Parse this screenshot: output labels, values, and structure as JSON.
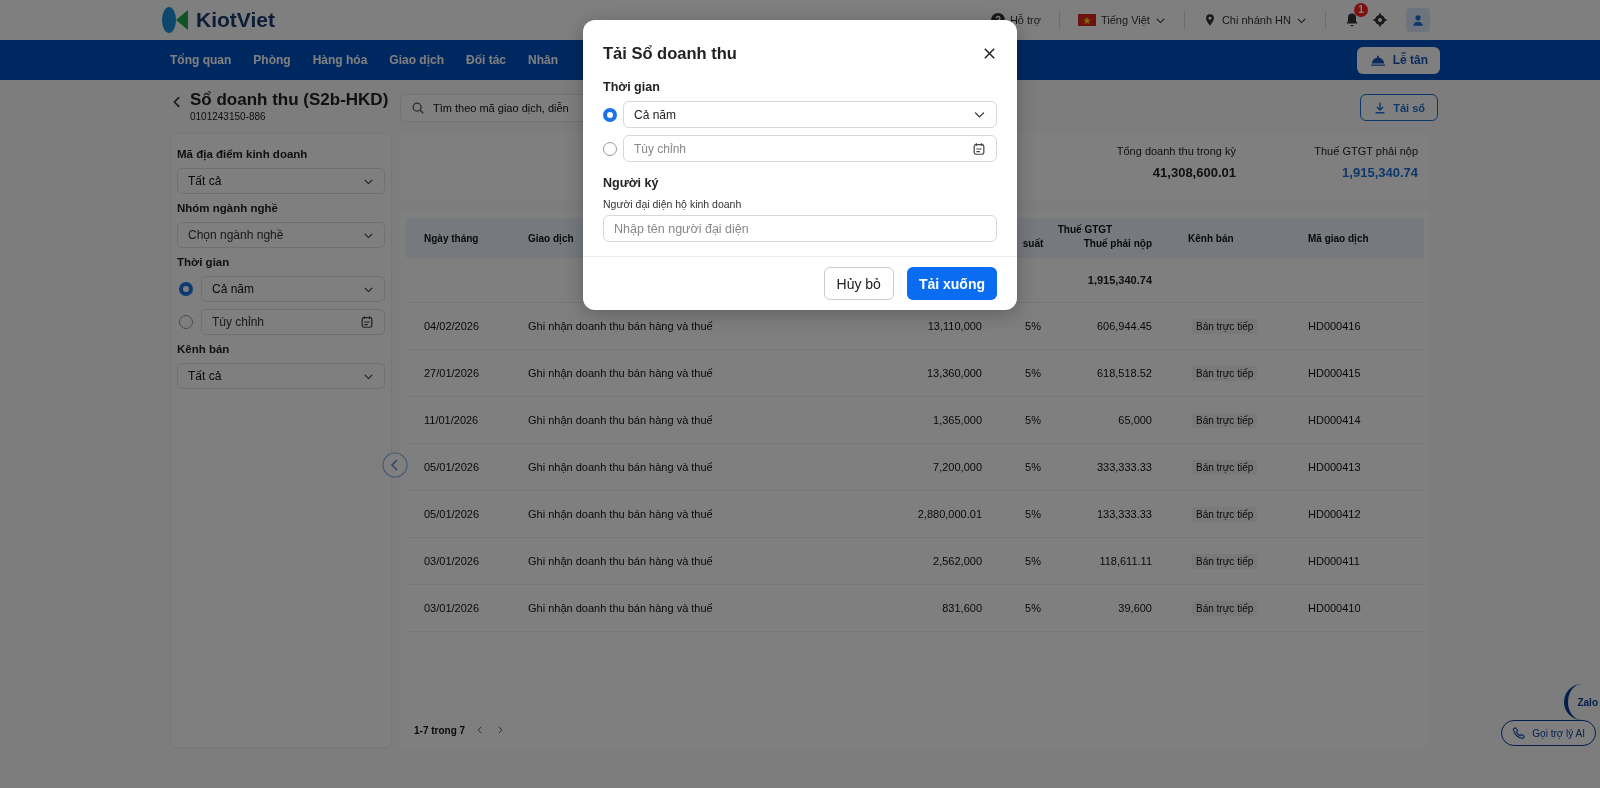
{
  "header": {
    "logo": "KiotViet",
    "support": "Hỗ trợ",
    "language": "Tiếng Việt",
    "branch": "Chi nhánh HN",
    "notification_count": "1"
  },
  "nav": {
    "items": [
      "Tổng quan",
      "Phòng",
      "Hàng hóa",
      "Giao dịch",
      "Đối tác",
      "Nhân"
    ],
    "reception_button": "Lễ tân"
  },
  "page": {
    "title": "Sổ doanh thu (S2b-HKD)",
    "subtitle": "0101243150-886",
    "search": {
      "placeholder": "Tìm theo mã giao dịch, diễn"
    },
    "download_button": "Tải sổ"
  },
  "filters": [
    {
      "kind": "select",
      "label": "Mã địa điểm kinh doanh",
      "value": "Tất cả"
    },
    {
      "kind": "select",
      "label": "Nhóm ngành nghề",
      "placeholder": "Chọn ngành nghề"
    },
    {
      "kind": "period",
      "label": "Thời gian",
      "options": [
        {
          "kind": "select",
          "value": "Cả năm",
          "selected": true
        },
        {
          "kind": "date",
          "placeholder": "Tùy chỉnh",
          "selected": false
        }
      ]
    },
    {
      "kind": "select",
      "label": "Kênh bán",
      "value": "Tất cả"
    }
  ],
  "summary": [
    {
      "label": "Tổng doanh thu trong kỳ",
      "value": "41,308,600.01",
      "highlight": false
    },
    {
      "label": "Thuế GTGT phải nộp",
      "value": "1,915,340.74",
      "highlight": true
    }
  ],
  "table": {
    "columns": [
      "Ngày tháng",
      "Giao dịch",
      "",
      "suất",
      "Thuế phải nộp",
      "Kênh bán",
      "Mã giao dịch"
    ],
    "column_group": "Thuế GTGT",
    "total_tax": "1,915,340.74",
    "rows": [
      {
        "date": "04/02/2026",
        "description": "Ghi nhận doanh thu bán hàng và thuế",
        "revenue": "13,110,000",
        "rate": "5%",
        "tax": "606,944.45",
        "channel": "Bán trực tiếp",
        "code": "HD000416"
      },
      {
        "date": "27/01/2026",
        "description": "Ghi nhận doanh thu bán hàng và thuế",
        "revenue": "13,360,000",
        "rate": "5%",
        "tax": "618,518.52",
        "channel": "Bán trực tiếp",
        "code": "HD000415"
      },
      {
        "date": "11/01/2026",
        "description": "Ghi nhận doanh thu bán hàng và thuế",
        "revenue": "1,365,000",
        "rate": "5%",
        "tax": "65,000",
        "channel": "Bán trực tiếp",
        "code": "HD000414"
      },
      {
        "date": "05/01/2026",
        "description": "Ghi nhận doanh thu bán hàng và thuế",
        "revenue": "7,200,000",
        "rate": "5%",
        "tax": "333,333.33",
        "channel": "Bán trực tiếp",
        "code": "HD000413"
      },
      {
        "date": "05/01/2026",
        "description": "Ghi nhận doanh thu bán hàng và thuế",
        "revenue": "2,880,000.01",
        "rate": "5%",
        "tax": "133,333.33",
        "channel": "Bán trực tiếp",
        "code": "HD000412"
      },
      {
        "date": "03/01/2026",
        "description": "Ghi nhận doanh thu bán hàng và thuế",
        "revenue": "2,562,000",
        "rate": "5%",
        "tax": "118,611.11",
        "channel": "Bán trực tiếp",
        "code": "HD000411"
      },
      {
        "date": "03/01/2026",
        "description": "Ghi nhận doanh thu bán hàng và thuế",
        "revenue": "831,600",
        "rate": "5%",
        "tax": "39,600",
        "channel": "Bán trực tiếp",
        "code": "HD000410"
      }
    ]
  },
  "pagination": "1-7 trong 7",
  "floating": {
    "zalo": "Zalo",
    "ai_button": "Gọi trợ lý AI"
  },
  "dialog": {
    "title": "Tải Sổ doanh thu",
    "period_label": "Thời gian",
    "period_options": [
      {
        "kind": "select",
        "value": "Cả năm",
        "selected": true
      },
      {
        "kind": "date",
        "placeholder": "Tùy chỉnh",
        "selected": false
      }
    ],
    "signer_label": "Người ký",
    "signer_field": {
      "label": "Người đại diện hộ kinh doanh",
      "placeholder": "Nhập tên người đại diện"
    },
    "buttons": [
      {
        "kind": "secondary",
        "label": "Hủy bỏ"
      },
      {
        "kind": "primary",
        "label": "Tải xuống"
      }
    ]
  }
}
